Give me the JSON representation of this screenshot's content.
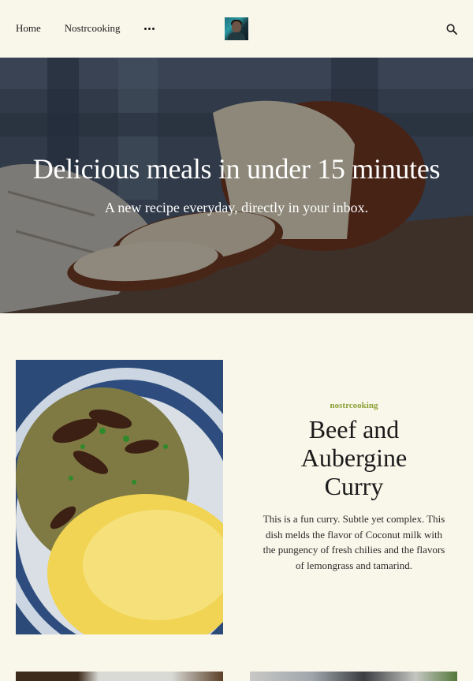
{
  "nav": {
    "items": [
      {
        "label": "Home"
      },
      {
        "label": "Nostrcooking"
      }
    ]
  },
  "icons": {
    "more": "more-horizontal-icon",
    "search": "search-icon",
    "avatar": "avatar"
  },
  "hero": {
    "title": "Delicious meals in under 15 minutes",
    "subtitle": "A new recipe everyday, directly in your inbox."
  },
  "post": {
    "author": "nostrcooking",
    "title": "Beef and Aubergine Curry",
    "excerpt": "This is a fun curry. Subtle yet complex. This dish melds the flavor of Coconut milk with the pungency of fresh chilies and the flavors of lemongrass and tamarind."
  },
  "colors": {
    "background": "#f9f6ea",
    "accent": "#8aa035",
    "text": "#1b1b1b"
  }
}
